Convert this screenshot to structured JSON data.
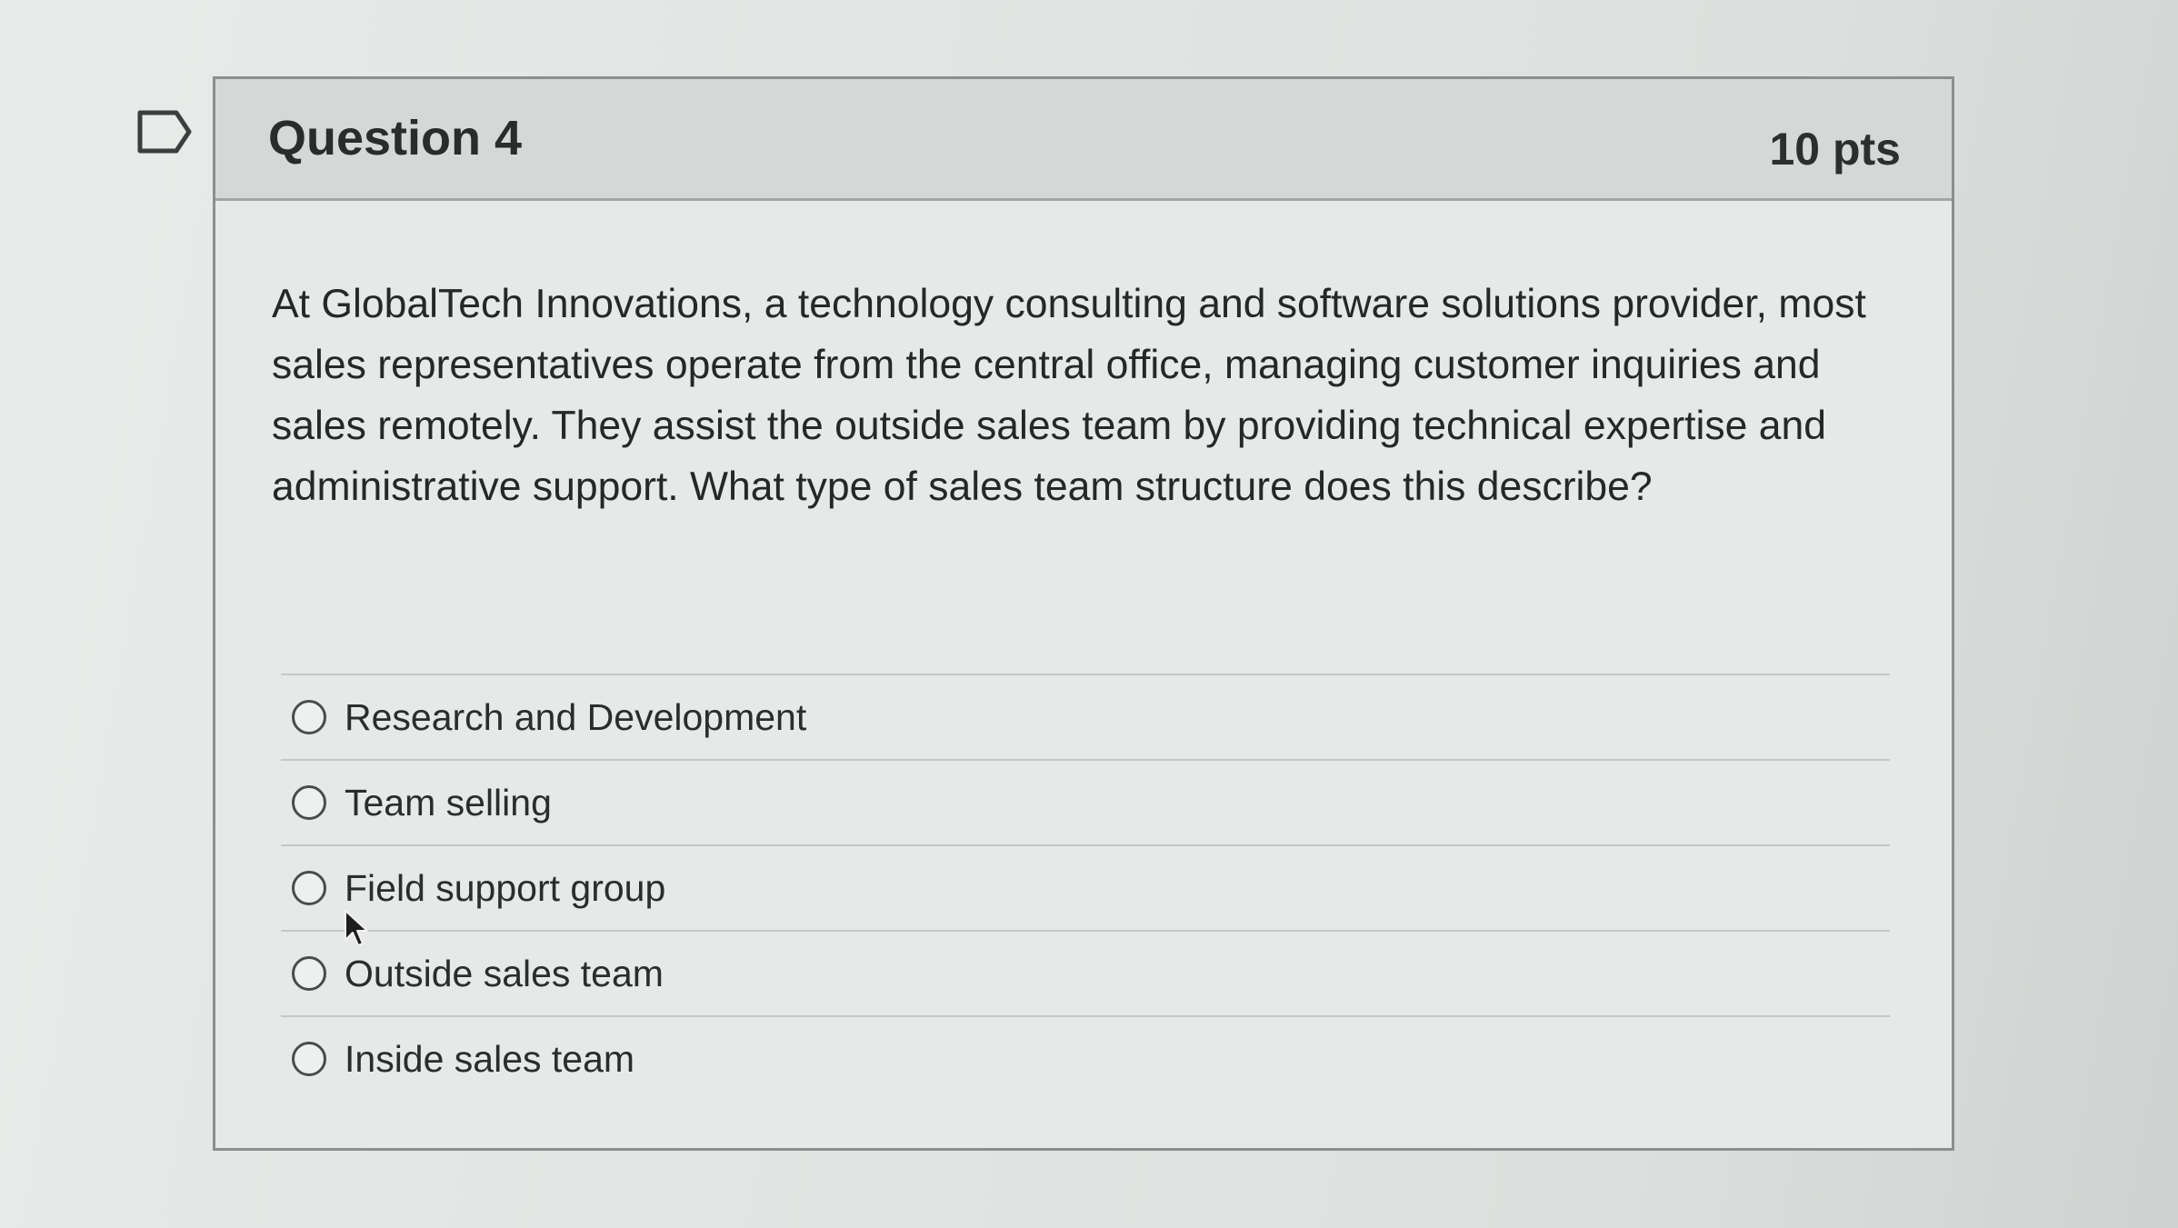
{
  "question": {
    "title": "Question 4",
    "points": "10 pts",
    "text": "At GlobalTech Innovations, a technology consulting and software solutions provider, most sales representatives operate from the central office, managing customer inquiries and sales remotely. They assist the outside sales team by providing technical expertise and administrative support. What type of sales team structure does this describe?"
  },
  "answers": [
    {
      "label": "Research and Development"
    },
    {
      "label": "Team selling"
    },
    {
      "label": "Field support group"
    },
    {
      "label": "Outside sales team"
    },
    {
      "label": "Inside sales team"
    }
  ],
  "icons": {
    "flag": "flag-outline-icon",
    "cursor": "mouse-pointer-icon"
  }
}
